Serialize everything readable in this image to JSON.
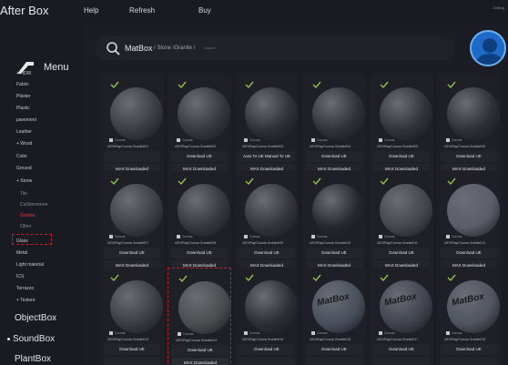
{
  "topbar": {
    "app_title": "After Box",
    "menu": [
      "Help",
      "Refresh",
      "Buy"
    ],
    "window_text": "Setting"
  },
  "sidebar": {
    "menu_label": "Menu",
    "items": [
      {
        "label": "+ HDRI",
        "kind": "nav"
      },
      {
        "label": "Fabric",
        "kind": "nav"
      },
      {
        "label": "Plaster",
        "kind": "nav"
      },
      {
        "label": "Plastic",
        "kind": "nav"
      },
      {
        "label": "pavement",
        "kind": "nav"
      },
      {
        "label": "Leather",
        "kind": "nav"
      },
      {
        "label": "+ Wood",
        "kind": "nav"
      },
      {
        "label": "Color",
        "kind": "nav"
      },
      {
        "label": "Ground",
        "kind": "nav"
      },
      {
        "label": "+ Stone",
        "kind": "nav"
      },
      {
        "label": "Tile",
        "kind": "sub"
      },
      {
        "label": "CutStonesree",
        "kind": "sub"
      },
      {
        "label": "Granite",
        "kind": "sub"
      },
      {
        "label": "Other",
        "kind": "sub"
      },
      {
        "label": "Glass",
        "kind": "nav"
      },
      {
        "label": "Metal",
        "kind": "nav"
      },
      {
        "label": "Light material",
        "kind": "nav"
      },
      {
        "label": "ICS",
        "kind": "nav"
      },
      {
        "label": "Terrazzo",
        "kind": "nav"
      },
      {
        "label": "+ Texture",
        "kind": "nav"
      }
    ],
    "sections": [
      "ObjectBox",
      "SoundBox",
      "PlantBox"
    ]
  },
  "search": {
    "brand": "MatBox",
    "path": "/ Stone /Granite /",
    "placeholder": "Search"
  },
  "colors": {
    "accent_check": "#8fc24a",
    "highlight": "#c0202a",
    "avatar": "#1e6ac8"
  },
  "cards": [
    {
      "engine": "Corona",
      "tags": "UE/VRay/Corona   Granite001",
      "ue": "",
      "max": "MAX Downloaded",
      "sphere": "#3a3c42"
    },
    {
      "engine": "Corona",
      "tags": "UE/VRay/Corona   Granite002",
      "ue": "Download UE",
      "max": "MAX Downloaded",
      "sphere": "#35373d"
    },
    {
      "engine": "Corona",
      "tags": "UE/VRay/Corona   Granite003",
      "ue": "Auto To UE     Manual To UE",
      "max": "MAX Downloaded",
      "sphere": "#2e3036"
    },
    {
      "engine": "Corona",
      "tags": "UE/VRay/Corona   Granite004",
      "ue": "Download UE",
      "max": "MAX Downloaded",
      "sphere": "#2f3137"
    },
    {
      "engine": "Corona",
      "tags": "UE/VRay/Corona   Granite005",
      "ue": "Download UE",
      "max": "MAX Downloaded",
      "sphere": "#303238"
    },
    {
      "engine": "Corona",
      "tags": "UE/VRay/Corona   Granite006",
      "ue": "Download UE",
      "max": "MAX Downloaded",
      "sphere": "#2d2f35"
    },
    {
      "engine": "Corona",
      "tags": "UE/VRay/Corona   Granite007",
      "ue": "Download UE",
      "max": "MAX Downloaded",
      "sphere": "#3c3e44"
    },
    {
      "engine": "Corona",
      "tags": "UE/VRay/Corona   Granite008",
      "ue": "Download UE",
      "max": "MAX Downloaded",
      "sphere": "#35373d"
    },
    {
      "engine": "Corona",
      "tags": "UE/VRay/Corona   Granite009",
      "ue": "Download UE",
      "max": "MAX Downloaded",
      "sphere": "#33353b"
    },
    {
      "engine": "Corona",
      "tags": "UE/VRay/Corona   Granite010",
      "ue": "Download UE",
      "max": "MAX Downloaded",
      "sphere": "#25272c"
    },
    {
      "engine": "Corona",
      "tags": "UE/VRay/Corona   Granite011",
      "ue": "Download UE",
      "max": "MAX Downloaded",
      "sphere": "#44464c"
    },
    {
      "engine": "Corona",
      "tags": "UE/VRay/Corona   Granite012",
      "ue": "Download UE",
      "max": "MAX Downloaded",
      "sphere": "#5a5d66"
    },
    {
      "engine": "Corona",
      "tags": "UE/VRay/Corona   Granite013",
      "ue": "Download UE",
      "max": "",
      "sphere": "#3a3d44"
    },
    {
      "engine": "Corona",
      "tags": "UE/VRay/Corona   Granite014",
      "ue": "Download UE",
      "max": "MAX Downloaded",
      "sphere": "#4a4c50"
    },
    {
      "engine": "Corona",
      "tags": "UE/VRay/Corona   Granite015",
      "ue": "Download UE",
      "max": "",
      "sphere": "#2c2e34"
    },
    {
      "engine": "Corona",
      "tags": "UE/VRay/Corona   Granite016",
      "ue": "Download UE",
      "max": "",
      "sphere": "#48505c",
      "brand": "MatBox"
    },
    {
      "engine": "Corona",
      "tags": "UE/VRay/Corona   Granite017",
      "ue": "Download UE",
      "max": "",
      "sphere": "#40444c",
      "brand": "MatBox"
    },
    {
      "engine": "Corona",
      "tags": "UE/VRay/Corona   Granite018",
      "ue": "Download UE",
      "max": "",
      "sphere": "#50545c",
      "brand": "MatBox"
    }
  ]
}
